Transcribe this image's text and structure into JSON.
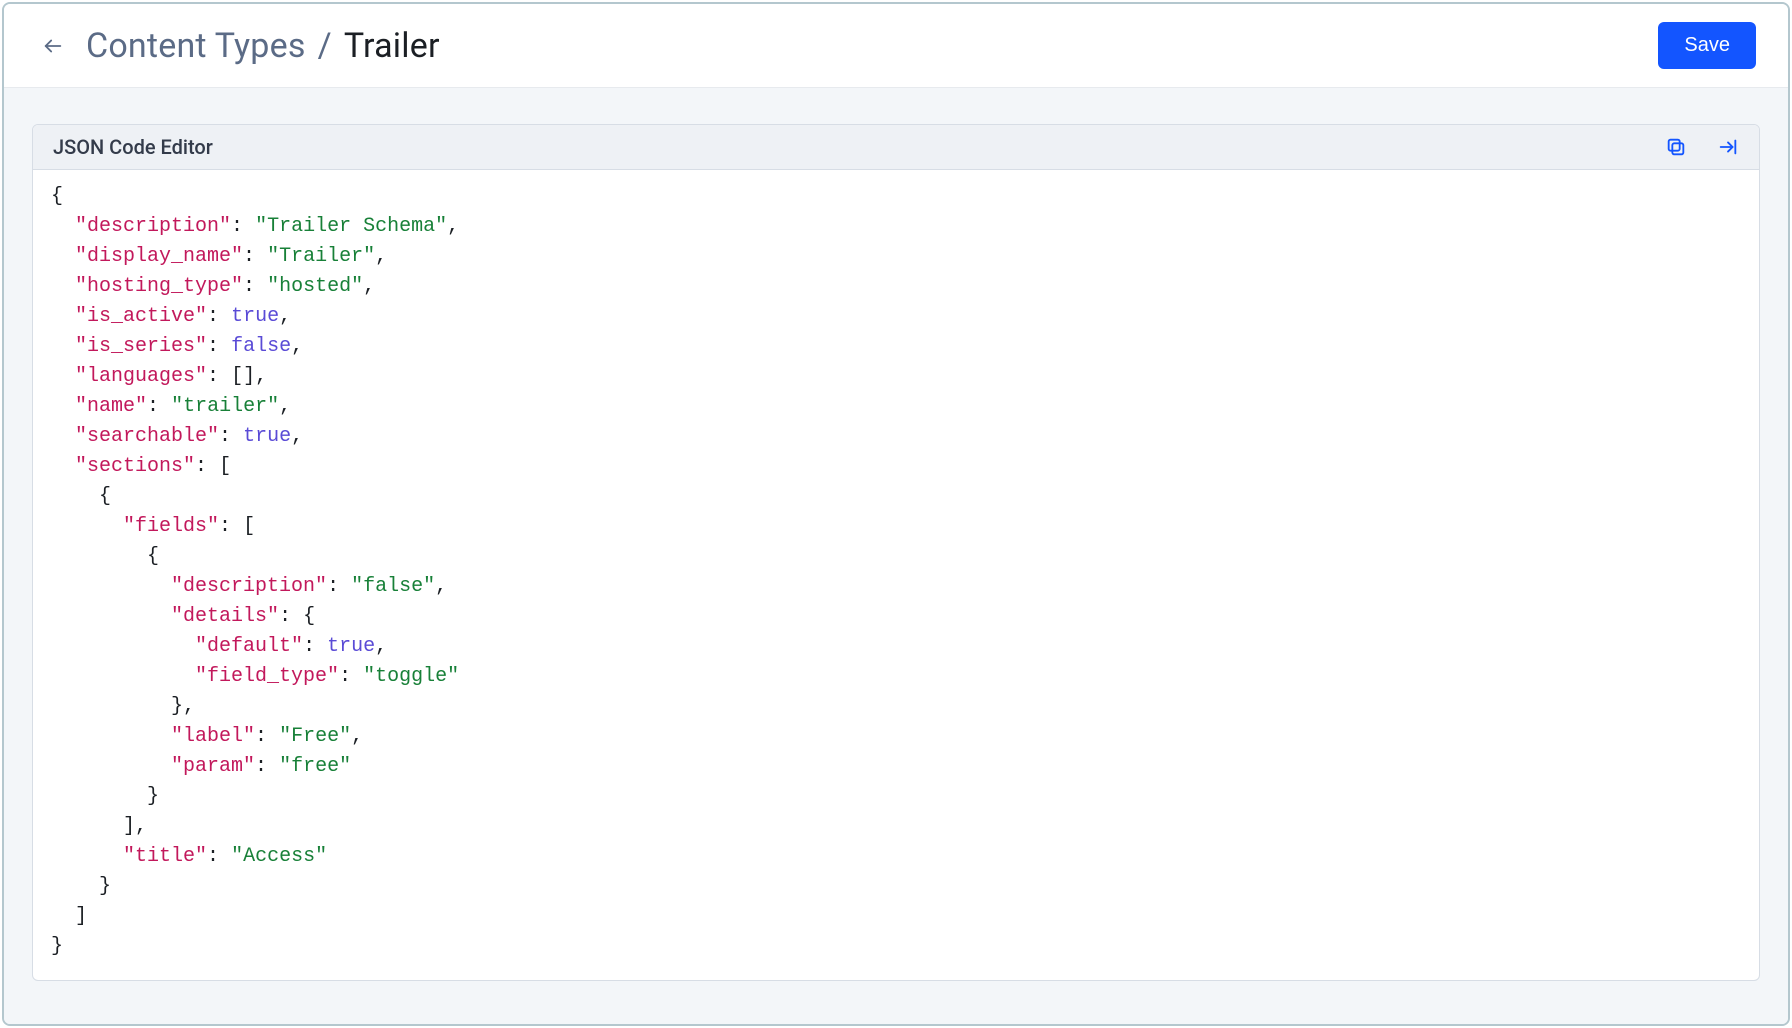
{
  "header": {
    "breadcrumb_root": "Content Types",
    "breadcrumb_sep": "/",
    "breadcrumb_leaf": "Trailer",
    "save_label": "Save"
  },
  "editor": {
    "title": "JSON Code Editor"
  },
  "json_content": {
    "description": "Trailer Schema",
    "display_name": "Trailer",
    "hosting_type": "hosted",
    "is_active": true,
    "is_series": false,
    "languages": [],
    "name": "trailer",
    "searchable": true,
    "sections": [
      {
        "fields": [
          {
            "description": "false",
            "details": {
              "default": true,
              "field_type": "toggle"
            },
            "label": "Free",
            "param": "free"
          }
        ],
        "title": "Access"
      }
    ]
  }
}
